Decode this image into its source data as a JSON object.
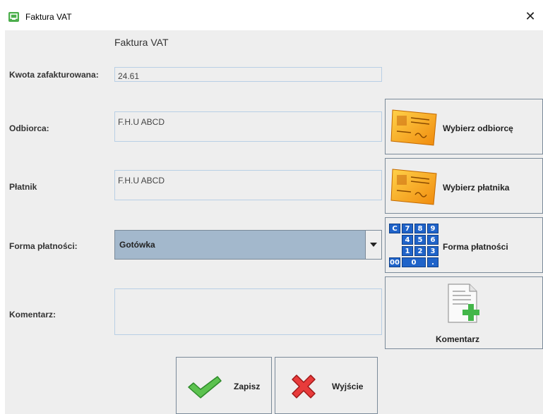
{
  "window": {
    "title": "Faktura VAT",
    "close_glyph": "✕"
  },
  "form": {
    "header": "Faktura VAT",
    "kwota": {
      "label": "Kwota zafakturowana:",
      "value": "24.61"
    },
    "odbiorca": {
      "label": "Odbiorca:",
      "value": "F.H.U ABCD"
    },
    "platnik": {
      "label": "Płatnik",
      "value": "F.H.U ABCD"
    },
    "forma": {
      "label": "Forma płatności:",
      "selected": "Gotówka"
    },
    "komentarz": {
      "label": "Komentarz:",
      "value": ""
    }
  },
  "buttons": {
    "wybierz_odbiorce": {
      "label": "Wybierz odbiorcę",
      "icon": "contact-card-icon"
    },
    "wybierz_platnika": {
      "label": "Wybierz płatnika",
      "icon": "contact-card-icon"
    },
    "forma_platnosci": {
      "label": "Forma płatności",
      "icon": "calculator-keypad-icon"
    },
    "komentarz": {
      "label": "Komentarz",
      "icon": "document-add-icon"
    },
    "zapisz": {
      "label": "Zapisz",
      "icon": "checkmark-icon"
    },
    "wyjscie": {
      "label": "Wyjście",
      "icon": "red-x-icon"
    }
  },
  "keypad_keys": [
    "C",
    "7",
    "8",
    "9",
    "4",
    "5",
    "6",
    "1",
    "2",
    "3",
    "00",
    "0",
    "."
  ],
  "colors": {
    "field_border": "#b8cfe5",
    "combo_bg": "#a3b8cc",
    "window_bg": "#eeeeee",
    "accent_green": "#4cae4c",
    "card_orange": "#f7a81b",
    "keypad_blue": "#1f63c9",
    "cancel_red": "#e03030"
  }
}
